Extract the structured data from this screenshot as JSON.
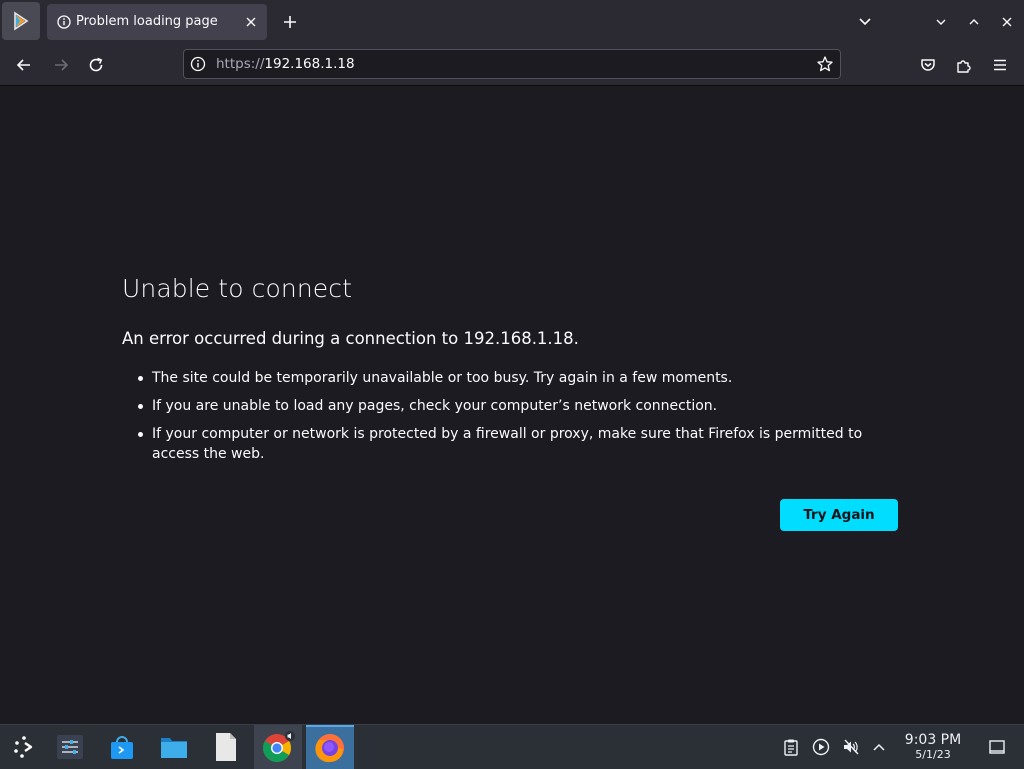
{
  "tabs": [
    {
      "title": "Problem loading page",
      "active": true
    }
  ],
  "url": {
    "scheme": "https://",
    "host": "192.168.1.18"
  },
  "error": {
    "title": "Unable to connect",
    "description": "An error occurred during a connection to 192.168.1.18.",
    "items": [
      "The site could be temporarily unavailable or too busy. Try again in a few moments.",
      "If you are unable to load any pages, check your computer’s network connection.",
      "If your computer or network is protected by a firewall or proxy, make sure that Firefox is permitted to access the web."
    ],
    "button_label": "Try Again"
  },
  "taskbar": {
    "apps": [
      "application-launcher-icon",
      "system-settings-icon",
      "discover-store-icon",
      "file-manager-icon",
      "text-file-icon",
      "chrome-icon",
      "firefox-icon"
    ],
    "tray": [
      "clipboard-icon",
      "media-player-icon",
      "volume-muted-icon",
      "tray-expand-icon"
    ],
    "clock": {
      "time": "9:03 PM",
      "date": "5/1/23"
    }
  },
  "colors": {
    "page_bg": "#1c1b22",
    "toolbar_bg": "#2b2a33",
    "accent": "#00ddff",
    "taskbar_bg": "#2b2f36"
  }
}
